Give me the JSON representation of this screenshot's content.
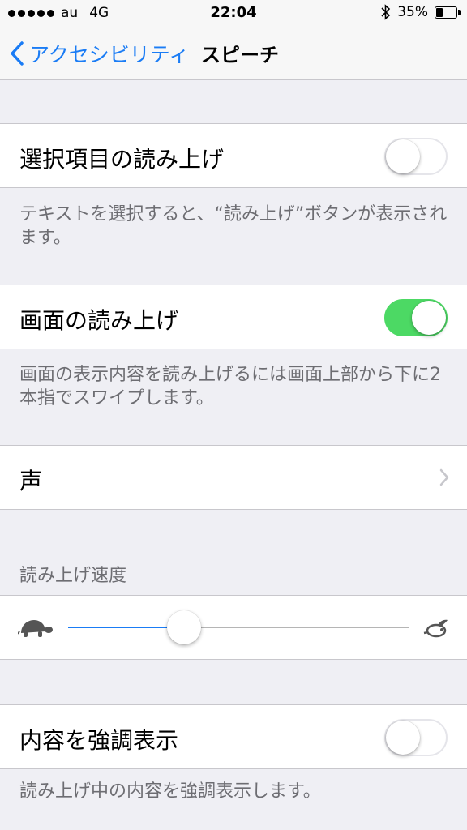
{
  "status_bar": {
    "carrier": "au",
    "network": "4G",
    "time": "22:04",
    "battery_text": "35%",
    "battery_level": 0.35,
    "icons": [
      "signal-dots-icon",
      "bluetooth-icon",
      "battery-icon"
    ]
  },
  "nav": {
    "back_label": "アクセシビリティ",
    "title": "スピーチ"
  },
  "settings": {
    "speak_selection": {
      "label": "選択項目の読み上げ",
      "on": false
    },
    "speak_selection_footer": "テキストを選択すると、“読み上げ”ボタンが表示されます。",
    "speak_screen": {
      "label": "画面の読み上げ",
      "on": true
    },
    "speak_screen_footer": "画面の表示内容を読み上げるには画面上部から下に2本指でスワイプします。",
    "voice": {
      "label": "声"
    },
    "rate_header": "読み上げ速度",
    "rate": {
      "value": 0.34,
      "min_icon": "turtle-icon",
      "max_icon": "rabbit-icon"
    },
    "highlight": {
      "label": "内容を強調表示",
      "on": false
    },
    "highlight_footer": "読み上げ中の内容を強調表示します。"
  },
  "colors": {
    "accent": "#1a7cf5",
    "toggle_on": "#4cd964",
    "background": "#efeff4",
    "footer_text": "#6d6d72"
  }
}
